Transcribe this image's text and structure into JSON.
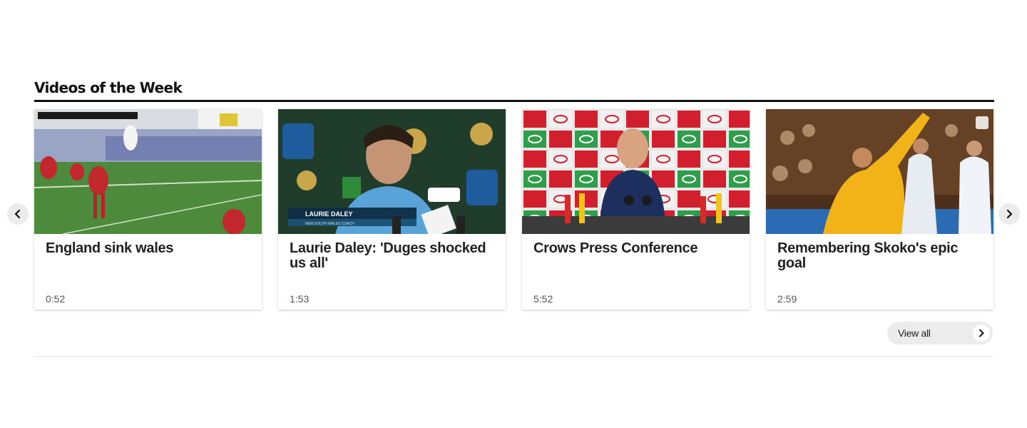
{
  "section": {
    "title": "Videos of the Week"
  },
  "videos": [
    {
      "title": "England sink wales",
      "duration": "0:52",
      "thumbnail": "rugby-match-thumbnail"
    },
    {
      "title": "Laurie Daley: 'Duges shocked us all'",
      "duration": "1:53",
      "thumbnail": "coach-interview-thumbnail",
      "lower_third_name": "LAURIE DALEY",
      "lower_third_role": "NEW SOUTH WALES COACH"
    },
    {
      "title": "Crows Press Conference",
      "duration": "5:52",
      "thumbnail": "press-conference-thumbnail"
    },
    {
      "title": "Remembering Skoko's epic goal",
      "duration": "2:59",
      "thumbnail": "soccer-celebration-thumbnail"
    }
  ],
  "view_all": {
    "label": "View all"
  },
  "icons": {
    "prev": "chevron-left-icon",
    "next": "chevron-right-icon",
    "view_all": "chevron-right-icon"
  },
  "colors": {
    "title_rule": "#111111",
    "pill_background": "#ececec"
  }
}
